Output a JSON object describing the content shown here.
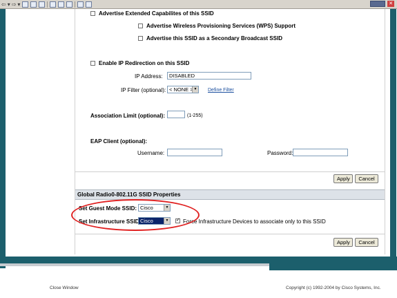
{
  "toolbar": {
    "back_label": "⇦",
    "forward_label": "⇨"
  },
  "wlan": {
    "advertise_extended": "Advertise Extended Capabilites of this SSID",
    "advertise_wps": "Advertise Wireless Provisioning Services (WPS) Support",
    "advertise_secondary": "Advertise this SSID as a Secondary Broadcast SSID",
    "enable_ip_redirection": "Enable IP Redirection on this SSID",
    "ip_address_label": "IP Address:",
    "ip_address_value": "DISABLED",
    "ip_filter_label": "IP Filter (optional):",
    "ip_filter_value": "< NONE >",
    "define_filter_link": "Define Filter",
    "association_limit_label": "Association Limit (optional):",
    "association_limit_range": "(1-255)",
    "association_limit_value": "",
    "eap_client_label": "EAP Client (optional):",
    "username_label": "Username:",
    "username_value": "",
    "password_label": "Password:",
    "password_value": "",
    "apply_label": "Apply",
    "cancel_label": "Cancel"
  },
  "global": {
    "section_title": "Global Radio0-802.11G SSID Properties",
    "guest_mode_label": "Set Guest Mode SSID:",
    "guest_mode_value": "Cisco",
    "infrastructure_label": "Set Infrastructure SSID:",
    "infrastructure_value": "Cisco",
    "force_infra_label": "Force Infrastructure Devices to associate only to this SSID",
    "force_infra_checked": true,
    "apply_label": "Apply",
    "cancel_label": "Cancel"
  },
  "footer": {
    "close_window": "Close Window",
    "copyright": "Copyright (c) 1992-2004 by Cisco Systems, Inc."
  },
  "colors": {
    "teal": "#1c5f6c",
    "highlight": "#e02020",
    "link": "#1b4f9e"
  }
}
